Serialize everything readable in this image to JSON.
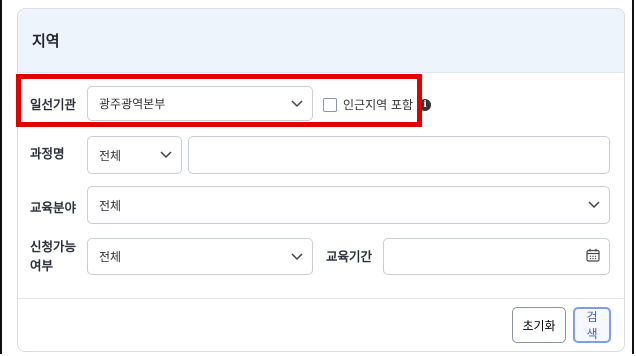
{
  "panel": {
    "title": "지역"
  },
  "fields": {
    "institution": {
      "label": "일선기관",
      "value": "광주광역본부",
      "nearby_checkbox_label": "인근지역 포함"
    },
    "course_name": {
      "label": "과정명",
      "select_value": "전체",
      "input_value": ""
    },
    "field": {
      "label": "교육분야",
      "value": "전체"
    },
    "availability": {
      "label_line1": "신청가능",
      "label_line2": "여부",
      "value": "전체"
    },
    "period": {
      "label": "교육기간",
      "value": ""
    }
  },
  "buttons": {
    "reset": "초기화",
    "search": "검색"
  },
  "icons": {
    "dropdown": "chevron-down-icon",
    "info": "info-icon",
    "calendar": "calendar-icon"
  },
  "colors": {
    "highlight": "#e00000",
    "header_bg": "#eef4fc",
    "search_accent": "#3a5fcf"
  }
}
